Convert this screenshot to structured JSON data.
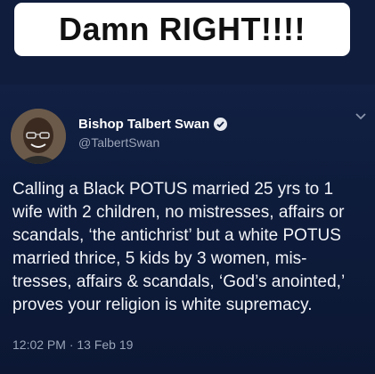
{
  "caption": {
    "text": "Damn RIGHT!!!!"
  },
  "tweet": {
    "display_name": "Bishop Talbert Swan",
    "handle": "@TalbertSwan",
    "verified_icon": "verified-badge-icon",
    "menu_icon": "chevron-down-icon",
    "body": "Calling a Black POTUS married 25 yrs to 1\nwife with 2 children, no mistresses, affairs or\nscandals, ‘the antichrist’ but a white POTUS\nmarried thrice, 5 kids by 3 women, mis-\ntresses, affairs & scandals, ‘God’s anointed,’\nproves your religion is white supremacy.",
    "timestamp": "12:02 PM · 13 Feb 19"
  },
  "colors": {
    "background": "#0f1d3e",
    "text": "#f2f4f8",
    "muted_text": "#9aa4b8",
    "caption_bg": "#ffffff"
  }
}
